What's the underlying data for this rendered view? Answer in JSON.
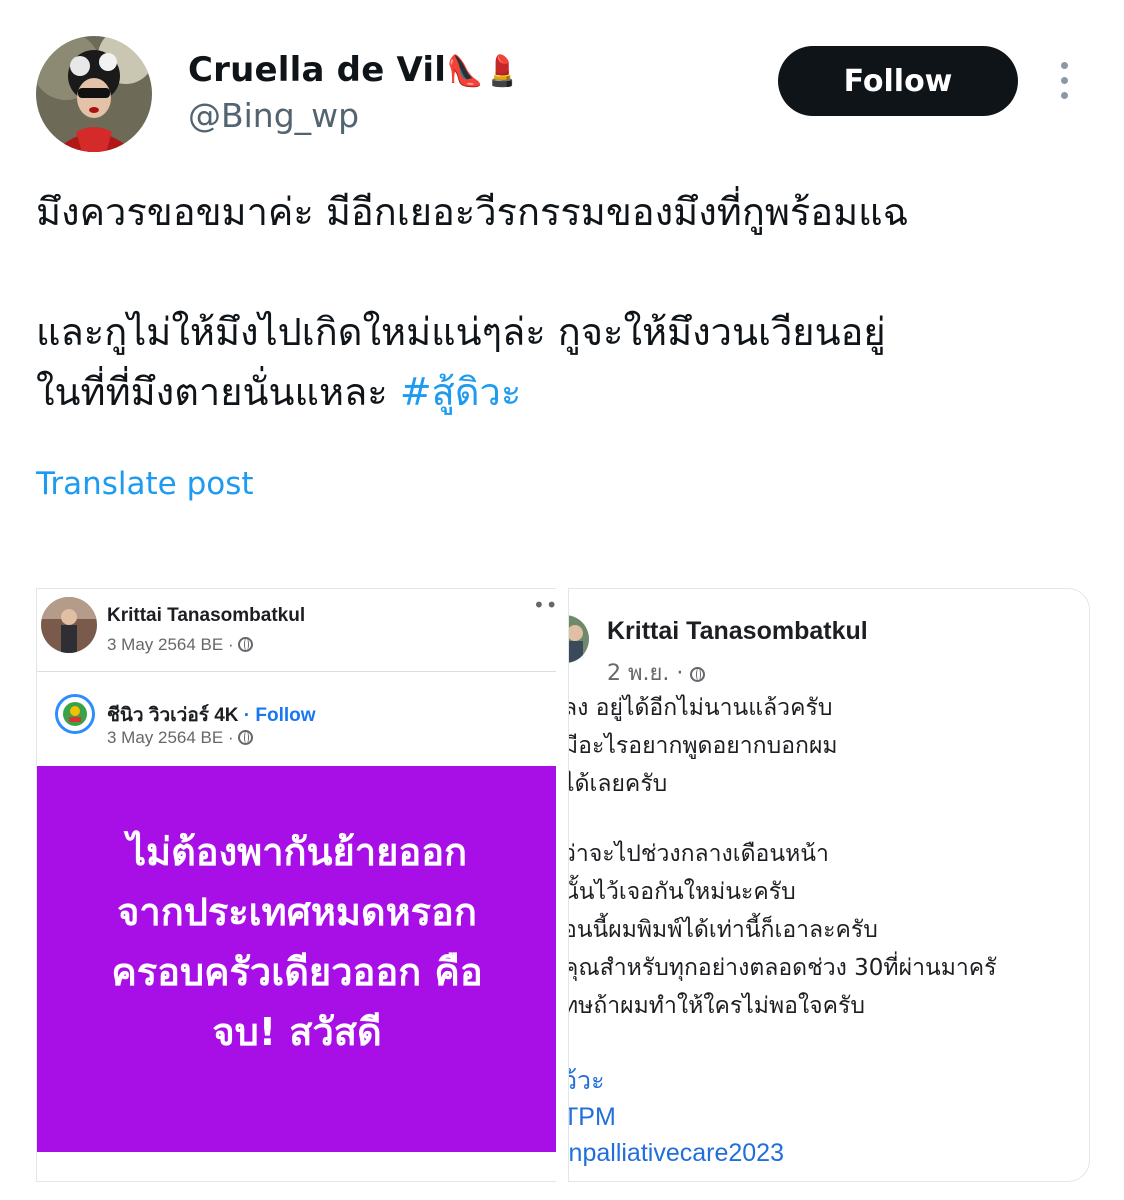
{
  "tweet": {
    "display_name": "Cruella de Vil",
    "name_emojis": "👠💄",
    "handle": "@Bing_wp",
    "follow_label": "Follow",
    "text_line_1": "มึงควรขอขมาค่ะ มีอีกเยอะวีรกรรมของมึงที่กูพร้อมแฉ",
    "text_line_2": "และกูไม่ให้มึงไปเกิดใหม่แน่ๆล่ะ กูจะให้มึงวนเวียนอยู่",
    "text_line_3": "ในที่ที่มึงตายนั่นแหละ",
    "hashtag": "#สู้ดิวะ",
    "translate_label": "Translate post"
  },
  "left_image": {
    "author": "Krittai Tanasombatkul",
    "date": "3 May 2564 BE ·",
    "more_label": "•••",
    "shared_page_name": "ชีนิว วิวเว่อร์ 4K",
    "shared_follow": "· Follow",
    "shared_date": "3 May 2564 BE ·",
    "card_lines": [
      "ไม่ต้องพากันย้ายออก",
      "จากประเทศหมดหรอก",
      "ครอบครัวเดียวออก คือ",
      "จบ! สวัสดี"
    ]
  },
  "right_image": {
    "author": "Krittai Tanasombatkul",
    "date": "2 พ.ย. ·",
    "body_lines": [
      "ลง อยู่ได้อีกไม่นานแล้วครับ",
      "มีอะไรอยากพูดอยากบอกผม",
      "ได้เลยครับ",
      "",
      "ว่าจะไปช่วงกลางเดือนหน้า",
      "นั้นไว้เจอกันใหม่นะครับ",
      "อนนี้ผมพิมพ์ได้เท่านี้ก็เอาละครับ",
      "คุณสำหรับทุกอย่างตลอดช่วง  30ที่ผ่านมาครั",
      "ทษถ้าผมทำให้ใครไม่พอใจครับ"
    ],
    "tags": [
      "ว้วะ",
      "TPM",
      "inpalliativecare2023"
    ]
  },
  "colors": {
    "link_blue": "#1d9bf0",
    "follow_button": "#0f1419",
    "purple_card": "#a80ee6",
    "fb_link_blue": "#216fdb"
  }
}
